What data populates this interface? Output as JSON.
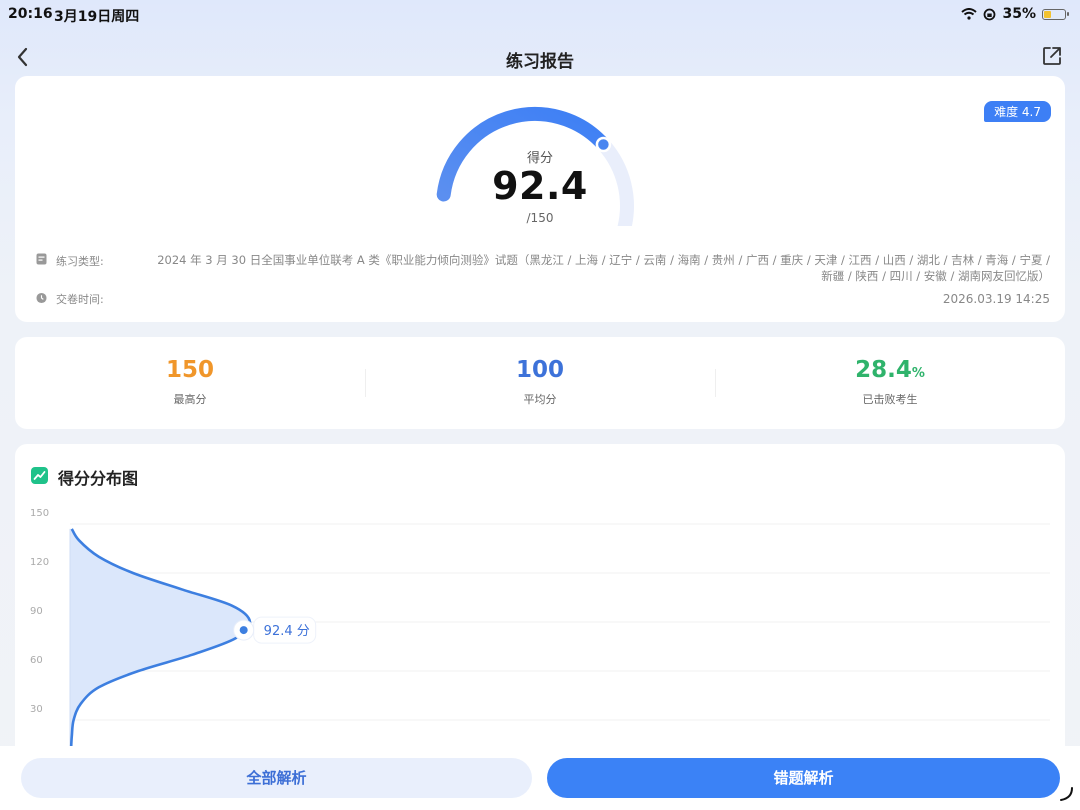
{
  "status_bar": {
    "time": "20:16",
    "date": "3月19日周四",
    "battery": "35%",
    "battery_level": 0.35
  },
  "nav": {
    "title": "练习报告",
    "back_icon": "chevron-left-icon",
    "share_icon": "share-icon"
  },
  "report": {
    "difficulty": "难度 4.7",
    "score_label": "得分",
    "score": "92.4",
    "score_max": "/150",
    "score_value": 92.4,
    "score_total": 150,
    "type_label": "练习类型:",
    "type_value": "2024 年 3 月 30 日全国事业单位联考 A 类《职业能力倾向测验》试题（黑龙江 / 上海 / 辽宁 / 云南 / 海南 / 贵州 / 广西 / 重庆 / 天津 / 江西 / 山西 / 湖北 / 吉林 / 青海 / 宁夏 / 新疆 / 陕西 / 四川 / 安徽 / 湖南网友回忆版）",
    "time_label": "交卷时间:",
    "time_value": "2026.03.19 14:25"
  },
  "stats": {
    "highest": {
      "value": "150",
      "label": "最高分",
      "color": "#f0962a"
    },
    "average": {
      "value": "100",
      "label": "平均分",
      "color": "#3d72d9"
    },
    "beaten": {
      "value": "28.4",
      "unit": "%",
      "label": "已击败考生",
      "color": "#2fb36b"
    }
  },
  "chart": {
    "title": "得分分布图",
    "icon": "trend-chart-icon",
    "marker_label": "92.4 分"
  },
  "chart_data": {
    "type": "area",
    "title": "得分分布图",
    "orientation": "horizontal-distribution",
    "y_ticks": [
      150,
      120,
      90,
      60,
      30
    ],
    "ylim": [
      0,
      150
    ],
    "y": [
      0,
      10,
      20,
      30,
      40,
      50,
      60,
      70,
      80,
      90,
      100,
      110,
      120,
      130,
      140,
      147
    ],
    "density": [
      0.0,
      0.005,
      0.01,
      0.02,
      0.06,
      0.16,
      0.38,
      0.68,
      0.92,
      1.0,
      0.9,
      0.62,
      0.35,
      0.16,
      0.05,
      0.01
    ],
    "marker": {
      "score": 92.4,
      "label": "92.4 分"
    },
    "grid": true,
    "color": "#3d7fe0"
  },
  "buttons": {
    "all_analysis": "全部解析",
    "wrong_analysis": "错题解析"
  }
}
